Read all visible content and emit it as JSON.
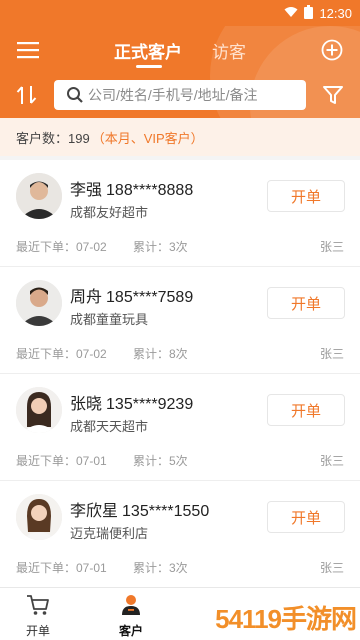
{
  "status_bar": {
    "time": "12:30"
  },
  "header": {
    "tabs": [
      {
        "label": "正式客户"
      },
      {
        "label": "访客"
      }
    ],
    "search_placeholder": "公司/姓名/手机号/地址/备注"
  },
  "summary": {
    "label": "客户数：199",
    "hint": "（本月、VIP客户）"
  },
  "customers": [
    {
      "name": "李强",
      "phone": "188****8888",
      "store": "成都友好超市",
      "last_order": "最近下单：07-02",
      "total": "累计：3次",
      "owner": "张三",
      "button": "开单"
    },
    {
      "name": "周舟",
      "phone": "185****7589",
      "store": "成都童童玩具",
      "last_order": "最近下单：07-02",
      "total": "累计：8次",
      "owner": "张三",
      "button": "开单"
    },
    {
      "name": "张晓",
      "phone": "135****9239",
      "store": "成都天天超市",
      "last_order": "最近下单：07-01",
      "total": "累计：5次",
      "owner": "张三",
      "button": "开单"
    },
    {
      "name": "李欣星",
      "phone": "135****1550",
      "store": "迈克瑞便利店",
      "last_order": "最近下单：07-01",
      "total": "累计：3次",
      "owner": "张三",
      "button": "开单"
    }
  ],
  "tab_bar": {
    "items": [
      {
        "label": "开单"
      },
      {
        "label": "客户"
      }
    ]
  },
  "watermark": "54119手游网",
  "colors": {
    "accent": "#f0782a",
    "hint": "#f0782a"
  }
}
